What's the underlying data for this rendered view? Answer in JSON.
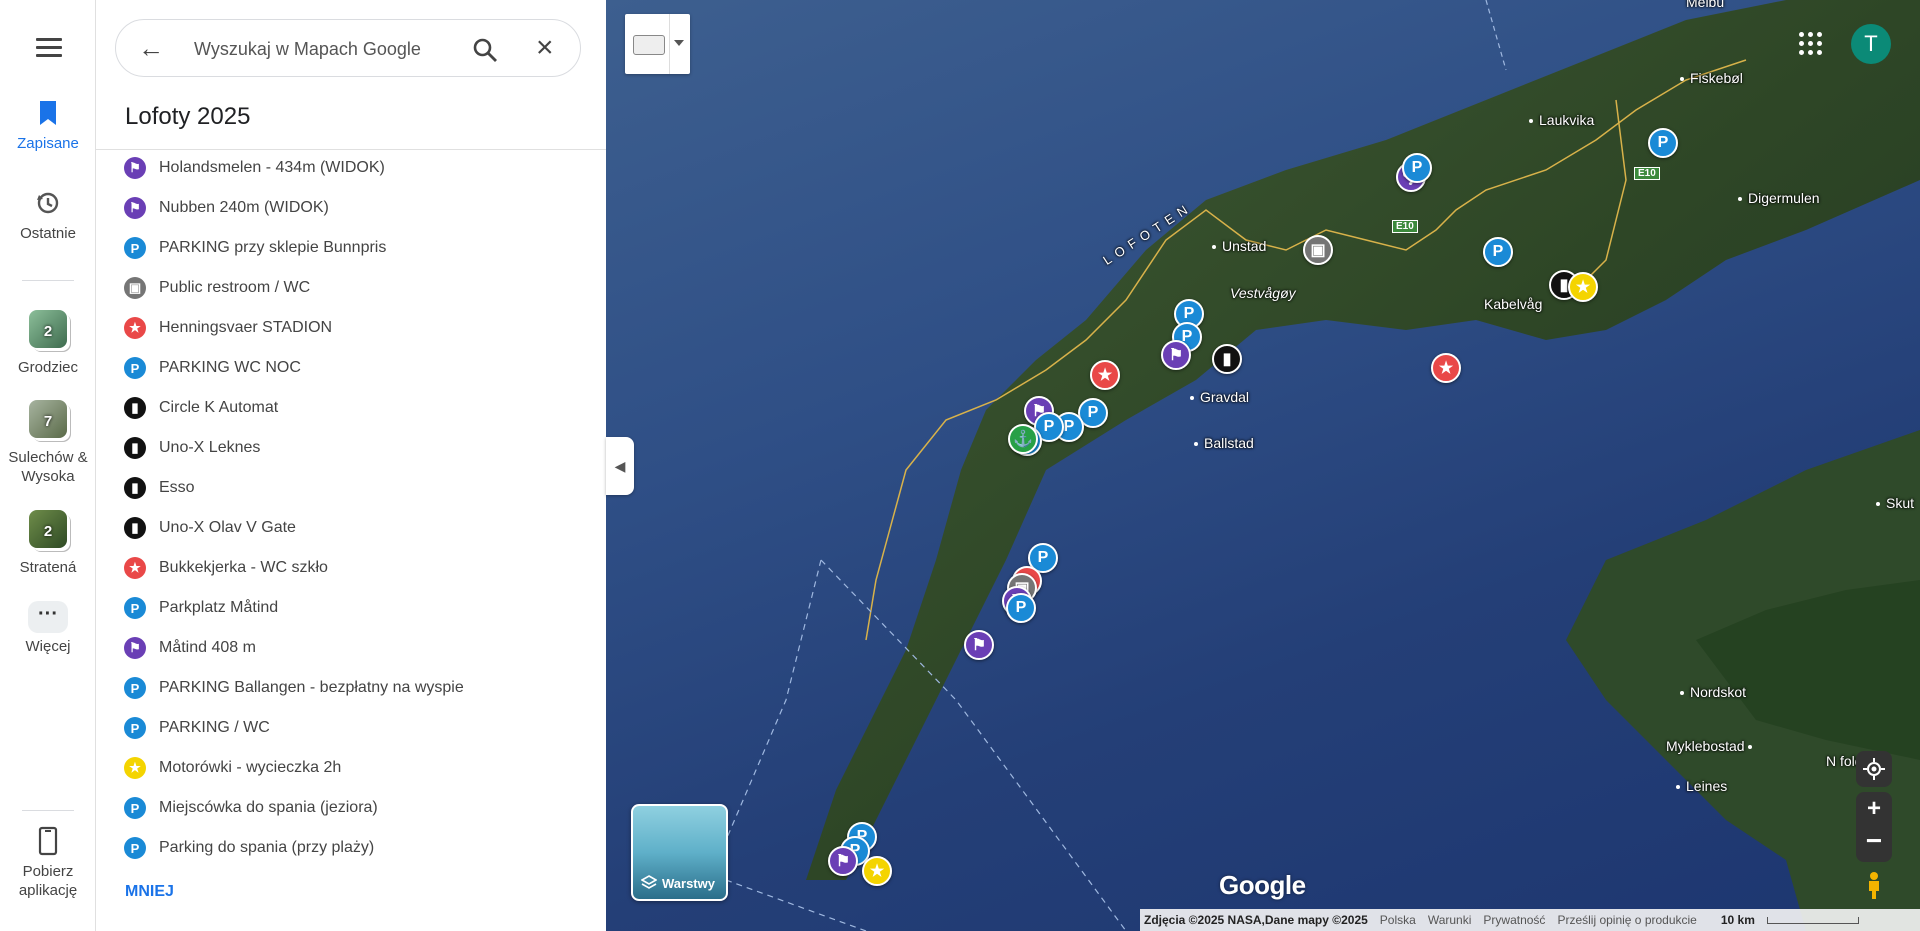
{
  "rail": {
    "saved": "Zapisane",
    "recent": "Ostatnie",
    "lists": [
      {
        "label": "Grodziec",
        "count": "2",
        "color": "#5b8f6c"
      },
      {
        "label": "Sulechów & Wysoka",
        "count": "7",
        "color": "#7c8d6a"
      },
      {
        "label": "Stratená",
        "count": "2",
        "color": "#4f6e3a"
      }
    ],
    "more": "Więcej",
    "get_app": "Pobierz aplikację"
  },
  "search": {
    "placeholder": "Wyszukaj w Mapach Google"
  },
  "list_title": "Lofoty 2025",
  "places": [
    {
      "name": "Holandsmelen - 434m (WIDOK)",
      "icon": "hiking-icon",
      "color": "#6a3fb5",
      "glyph": "⚑"
    },
    {
      "name": "Nubben 240m (WIDOK)",
      "icon": "hiking-icon",
      "color": "#6a3fb5",
      "glyph": "⚑"
    },
    {
      "name": "PARKING przy sklepie Bunnpris",
      "icon": "parking-icon",
      "color": "#1a8ad6",
      "glyph": "P"
    },
    {
      "name": "Public restroom / WC",
      "icon": "restroom-icon",
      "color": "#757575",
      "glyph": "▣"
    },
    {
      "name": "Henningsvaer STADION",
      "icon": "star-icon",
      "color": "#e94848",
      "glyph": "★"
    },
    {
      "name": "PARKING WC NOC",
      "icon": "parking-icon",
      "color": "#1a8ad6",
      "glyph": "P"
    },
    {
      "name": "Circle K Automat",
      "icon": "fuel-icon",
      "color": "#111111",
      "glyph": "▮"
    },
    {
      "name": "Uno-X Leknes",
      "icon": "fuel-icon",
      "color": "#111111",
      "glyph": "▮"
    },
    {
      "name": "Esso",
      "icon": "fuel-icon",
      "color": "#111111",
      "glyph": "▮"
    },
    {
      "name": "Uno-X Olav V Gate",
      "icon": "fuel-icon",
      "color": "#111111",
      "glyph": "▮"
    },
    {
      "name": "Bukkekjerka - WC szkło",
      "icon": "star-icon",
      "color": "#e94848",
      "glyph": "★"
    },
    {
      "name": "Parkplatz Måtind",
      "icon": "parking-icon",
      "color": "#1a8ad6",
      "glyph": "P"
    },
    {
      "name": "Måtind 408 m",
      "icon": "hiking-icon",
      "color": "#6a3fb5",
      "glyph": "⚑"
    },
    {
      "name": "PARKING Ballangen - bezpłatny na wyspie",
      "icon": "parking-icon",
      "color": "#1a8ad6",
      "glyph": "P"
    },
    {
      "name": "PARKING / WC",
      "icon": "parking-icon",
      "color": "#1a8ad6",
      "glyph": "P"
    },
    {
      "name": "Motorówki - wycieczka 2h",
      "icon": "star-icon",
      "color": "#f4d400",
      "glyph": "★"
    },
    {
      "name": "Miejscówka do spania (jeziora)",
      "icon": "parking-icon",
      "color": "#1a8ad6",
      "glyph": "P"
    },
    {
      "name": "Parking do spania (przy plaży)",
      "icon": "parking-icon",
      "color": "#1a8ad6",
      "glyph": "P"
    }
  ],
  "less_label": "MNIEJ",
  "map": {
    "avatar_letter": "T",
    "layers_label": "Warstwy",
    "logo": "Google",
    "labels": {
      "melbu": "Melbu",
      "fiskebol": "Fiskebøl",
      "laukvika": "Laukvika",
      "digermulen": "Digermulen",
      "lofoten": "LOFOTEN",
      "unstad": "Unstad",
      "vestvagoy": "Vestvågøy",
      "kabelvag": "Kabelvåg",
      "gravdal": "Gravdal",
      "ballstad": "Ballstad",
      "skut": "Skut",
      "nordskot": "Nordskot",
      "myklebostad": "Myklebostad",
      "leines": "Leines",
      "nordfold": "N  fold",
      "e10a": "E10",
      "e10b": "E10"
    },
    "footer": {
      "attribution": "Zdjęcia ©2025 NASA,Dane mapy ©2025",
      "country": "Polska",
      "terms": "Warunki",
      "privacy": "Prywatność",
      "feedback": "Prześlij opinię o produkcie",
      "scale": "10 km"
    }
  }
}
